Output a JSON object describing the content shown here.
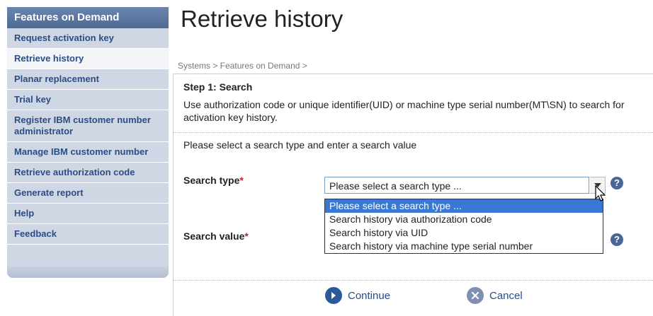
{
  "sidebar": {
    "header": "Features on Demand",
    "items": [
      {
        "label": "Request activation key"
      },
      {
        "label": "Retrieve history"
      },
      {
        "label": "Planar replacement"
      },
      {
        "label": "Trial key"
      },
      {
        "label": "Register IBM customer number administrator"
      },
      {
        "label": "Manage IBM customer number"
      },
      {
        "label": "Retrieve authorization code"
      },
      {
        "label": "Generate report"
      },
      {
        "label": "Help"
      },
      {
        "label": "Feedback"
      }
    ],
    "active_index": 1
  },
  "main": {
    "title": "Retrieve history",
    "breadcrumb": "Systems > Features on Demand >",
    "step_title": "Step 1: Search",
    "step_desc": "Use authorization code or unique identifier(UID) or machine type serial number(MT\\SN) to search for activation key history.",
    "instruction": "Please select a search type and enter a search value",
    "search_type_label": "Search type",
    "search_value_label": "Search value",
    "required_mark": "*",
    "select_value": "Please select a search type ...",
    "dropdown_options": [
      "Please select a search type ...",
      "Search history via authorization code",
      "Search history via UID",
      "Search history via machine type serial number"
    ],
    "help_glyph": "?",
    "continue_label": "Continue",
    "cancel_label": "Cancel"
  },
  "icons": {
    "dropdown_arrow": "chevron-down-icon",
    "help": "help-icon",
    "continue": "arrow-right-icon",
    "cancel": "close-icon",
    "cursor": "mouse-cursor-icon"
  },
  "colors": {
    "sidebar_header": "#4e6a95",
    "sidebar_bg": "#cfd7e4",
    "link": "#2a4d86",
    "selected_option": "#3a78d4",
    "required": "#c0272d"
  }
}
